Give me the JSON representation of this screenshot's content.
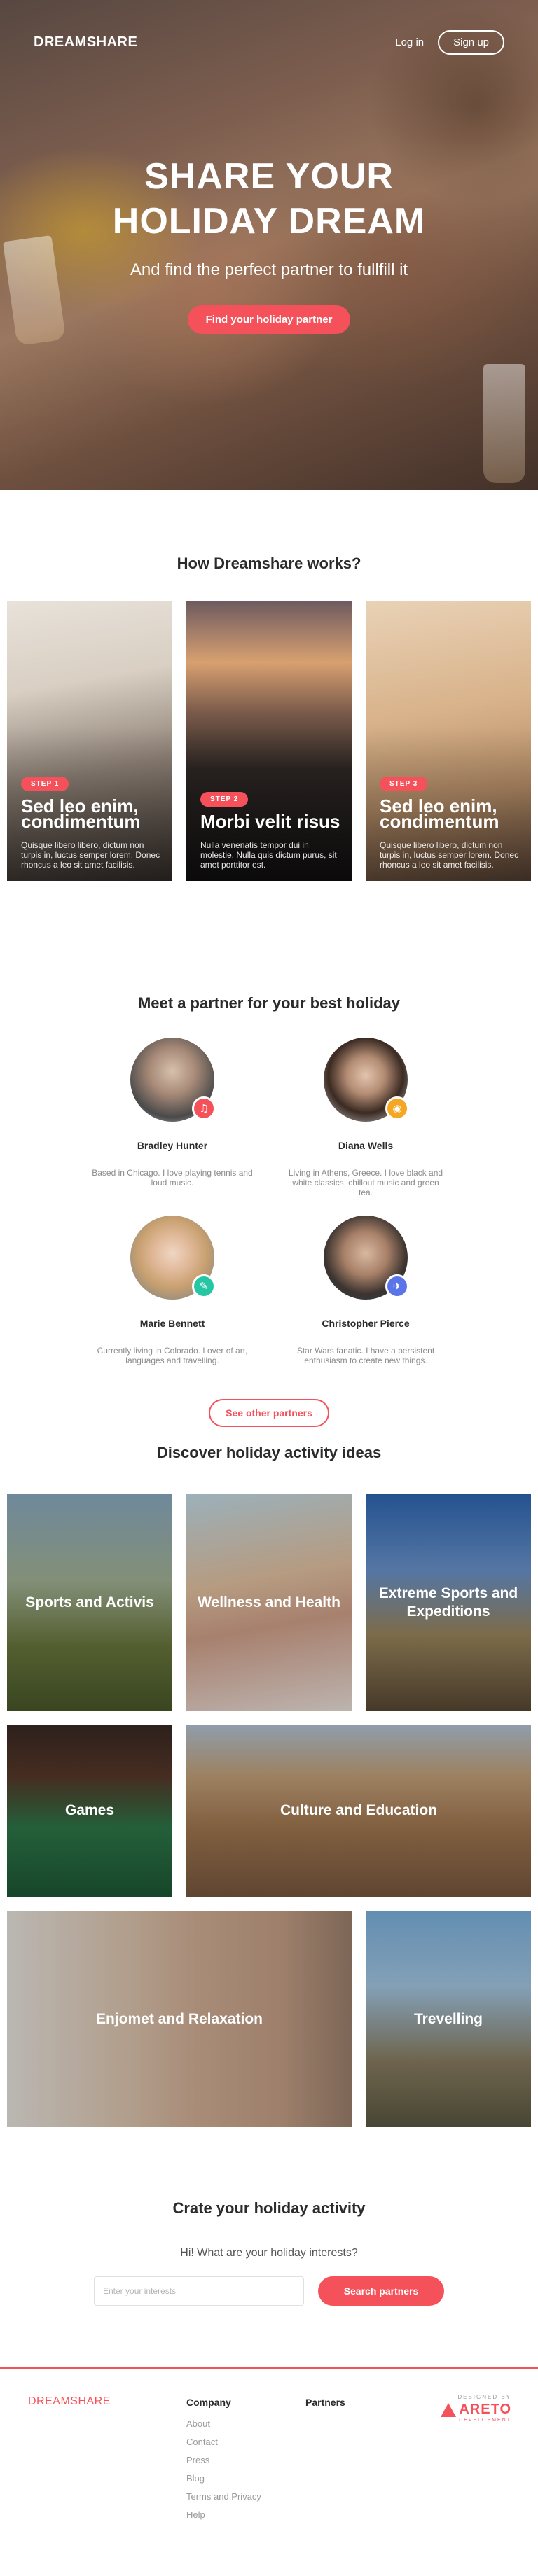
{
  "header": {
    "logo": "DREAMSHARE",
    "login_label": "Log in",
    "signup_label": "Sign up"
  },
  "hero": {
    "title_line1": "SHARE YOUR",
    "title_line2": "HOLIDAY DREAM",
    "subtitle": "And find the perfect partner to fullfill it",
    "cta_label": "Find your holiday partner"
  },
  "how": {
    "title": "How Dreamshare works?",
    "steps": [
      {
        "badge": "STEP 1",
        "title": "Sed leo enim, condimentum",
        "text": "Quisque libero libero, dictum non turpis in, luctus semper lorem. Donec rhoncus a leo sit amet facilisis."
      },
      {
        "badge": "STEP 2",
        "title": "Morbi velit risus",
        "text": "Nulla venenatis tempor dui in molestie. Nulla quis dictum purus, sit amet porttitor est."
      },
      {
        "badge": "STEP 3",
        "title": "Sed leo enim, condimentum",
        "text": "Quisque libero libero, dictum non turpis in, luctus semper lorem. Donec rhoncus a leo sit amet facilisis."
      }
    ]
  },
  "partners": {
    "title": "Meet a partner for your best holiday",
    "list": [
      {
        "name": "Bradley Hunter",
        "bio": "Based in Chicago. I love playing tennis and loud music.",
        "badge_icon": "music-icon",
        "badge_glyph": "♫",
        "badge_color": "#f4515b"
      },
      {
        "name": "Diana Wells",
        "bio": "Living in Athens, Greece. I love black and white classics, chillout music and green tea.",
        "badge_icon": "camera-icon",
        "badge_glyph": "◉",
        "badge_color": "#f5a623"
      },
      {
        "name": "Marie Bennett",
        "bio": "Currently living in Colorado. Lover of art, languages and travelling.",
        "badge_icon": "brush-icon",
        "badge_glyph": "✎",
        "badge_color": "#26c6a4"
      },
      {
        "name": "Christopher Pierce",
        "bio": "Star Wars fanatic. I have a persistent enthusiasm to create new things.",
        "badge_icon": "plane-icon",
        "badge_glyph": "✈",
        "badge_color": "#5b74e8"
      }
    ],
    "see_more_label": "See other partners"
  },
  "activities": {
    "title": "Discover holiday activity ideas",
    "tiles": [
      {
        "label": "Sports and Activis"
      },
      {
        "label": "Wellness and Health"
      },
      {
        "label": "Extreme Sports and Expeditions"
      },
      {
        "label": "Games"
      },
      {
        "label": "Culture and Education"
      },
      {
        "label": "Enjomet and Relaxation"
      },
      {
        "label": "Trevelling"
      }
    ]
  },
  "create": {
    "title": "Crate your holiday activity",
    "question": "Hi! What are your holiday interests?",
    "input_placeholder": "Enter your interests",
    "search_label": "Search partners"
  },
  "footer": {
    "logo": "DREAMSHARE",
    "company_head": "Company",
    "company_links": [
      "About",
      "Contact",
      "Press",
      "Blog",
      "Terms and Privacy",
      "Help"
    ],
    "partners_head": "Partners",
    "designed_by": "DESIGNED BY",
    "brand": "ARETO",
    "brand_sub": "DEVELOPMENT"
  },
  "colors": {
    "accent": "#f4515b",
    "text_dark": "#2b2b2b",
    "text_muted": "#8b8b8b"
  }
}
